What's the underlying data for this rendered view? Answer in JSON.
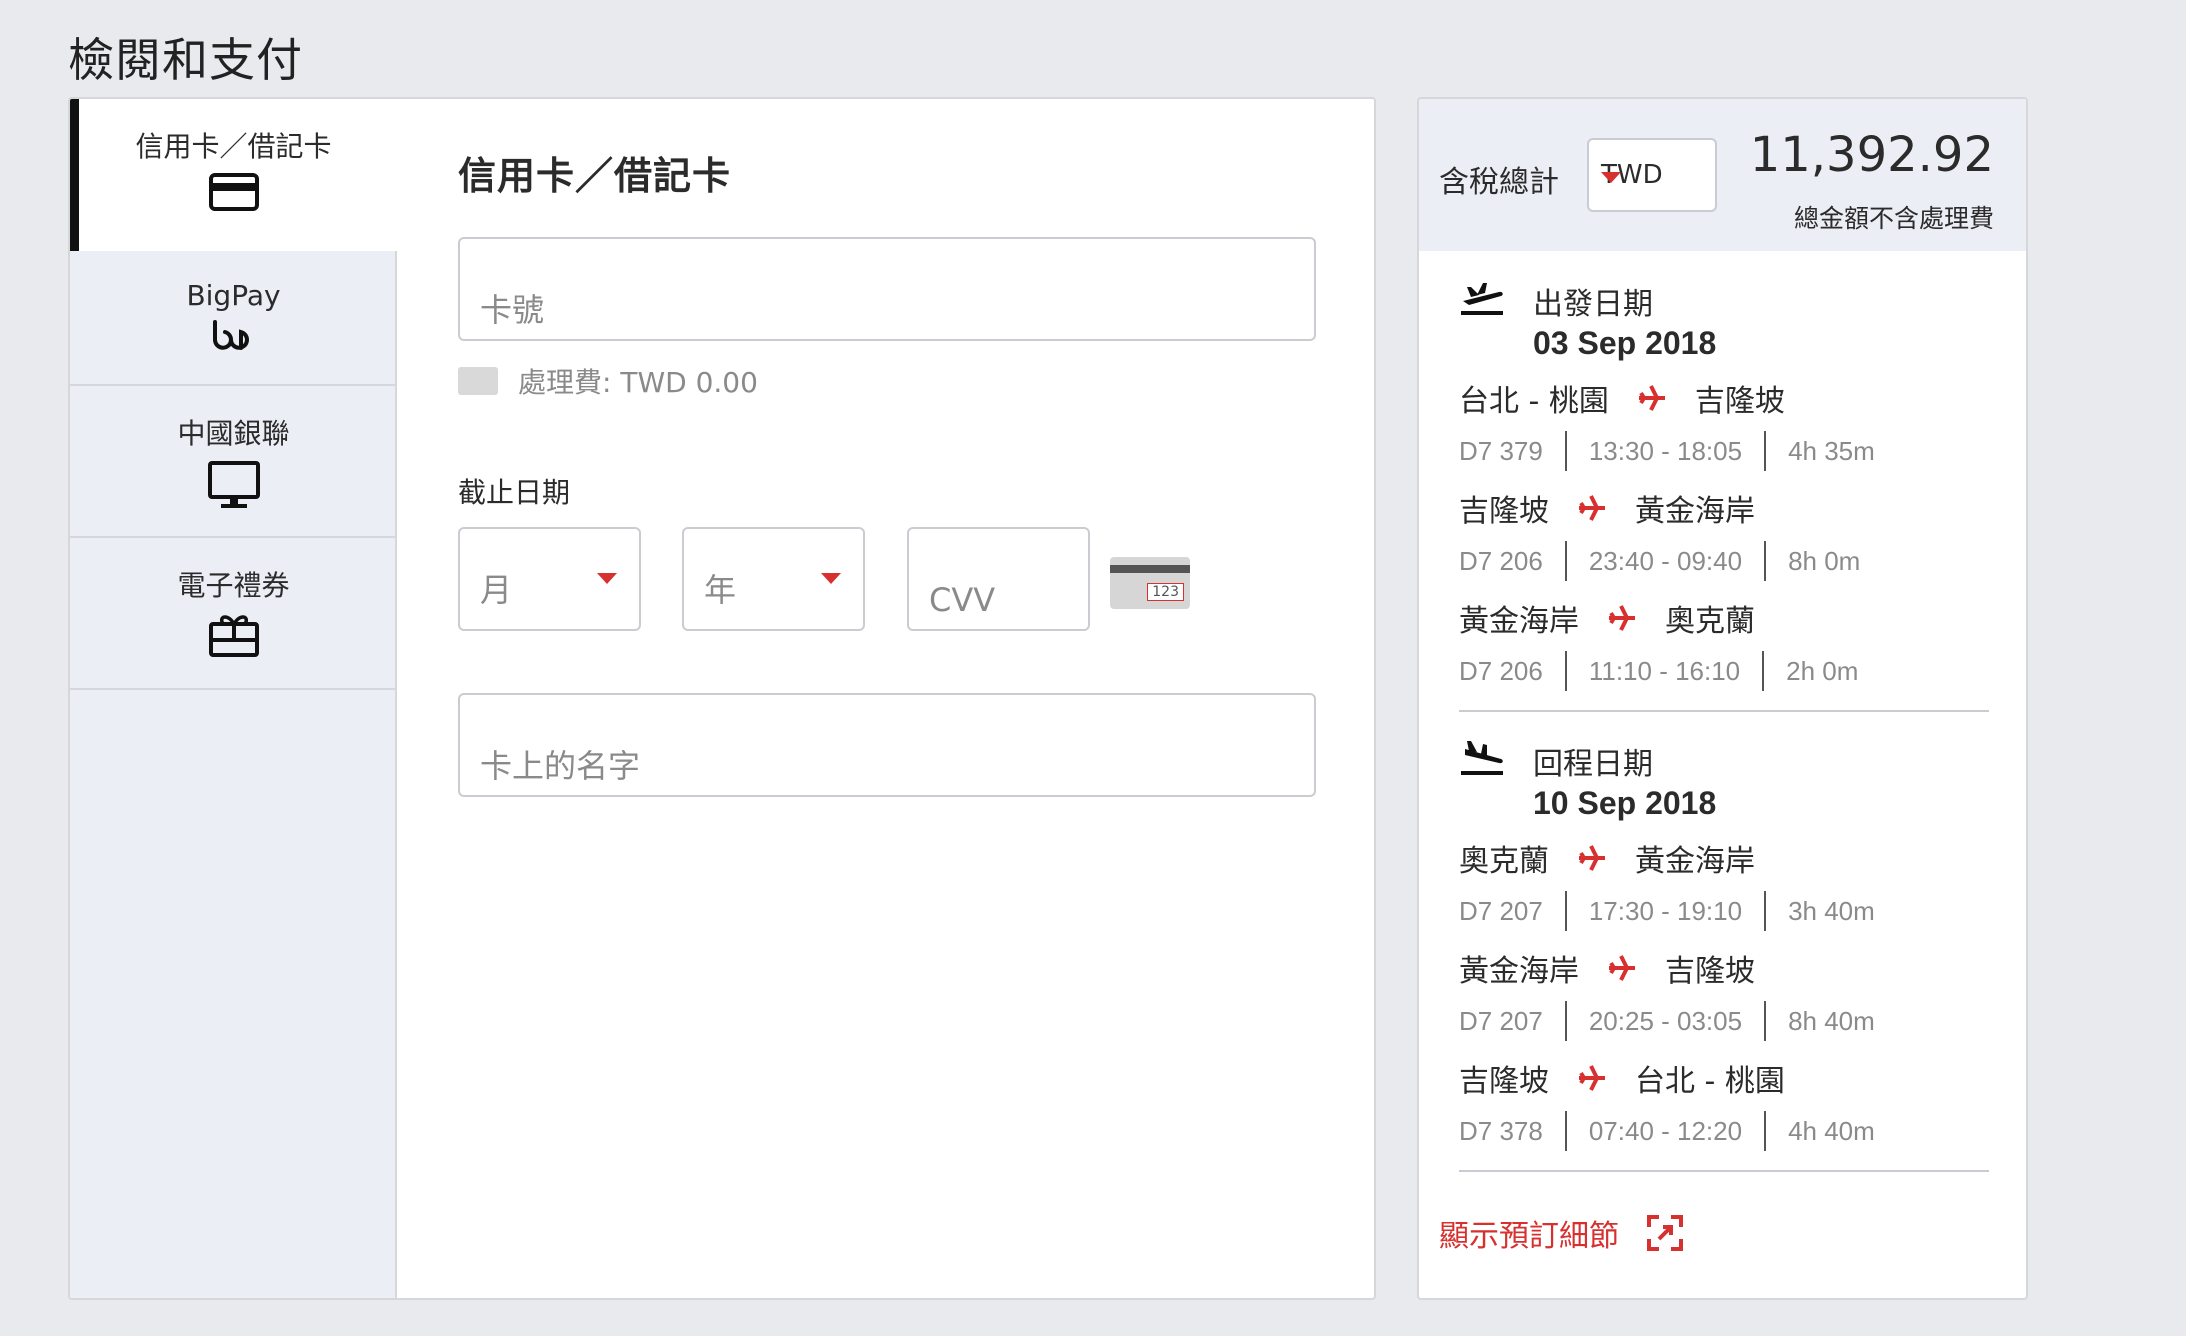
{
  "page": {
    "title": "檢閱和支付"
  },
  "colors": {
    "accent": "#d6302f",
    "panel_bg": "#eceef5",
    "page_bg": "#e9eaee"
  },
  "payment_tabs": [
    {
      "label": "信用卡／借記卡",
      "icon": "credit-card-icon",
      "active": true
    },
    {
      "label": "BigPay",
      "icon": "bigpay-icon",
      "active": false
    },
    {
      "label": "中國銀聯",
      "icon": "monitor-icon",
      "active": false
    },
    {
      "label": "電子禮券",
      "icon": "gift-card-icon",
      "active": false
    }
  ],
  "card_form": {
    "heading": "信用卡／借記卡",
    "card_number_placeholder": "卡號",
    "fee_text": "處理費: TWD 0.00",
    "expiry_label": "截止日期",
    "month_placeholder": "月",
    "year_placeholder": "年",
    "cvv_placeholder": "CVV",
    "cvv_card_number": "123",
    "name_placeholder": "卡上的名字"
  },
  "summary": {
    "total_label": "含稅總計",
    "currency": "TWD",
    "total_amount": "11,392.92",
    "total_note": "總金額不含處理費",
    "details_link": "顯示預訂細節",
    "departure": {
      "title": "出發日期",
      "date": "03 Sep 2018",
      "segments": [
        {
          "from": "台北 - 桃園",
          "to": "吉隆坡",
          "flight": "D7 379",
          "time": "13:30 - 18:05",
          "duration": "4h 35m"
        },
        {
          "from": "吉隆坡",
          "to": "黃金海岸",
          "flight": "D7 206",
          "time": "23:40 - 09:40",
          "duration": "8h 0m"
        },
        {
          "from": "黃金海岸",
          "to": "奧克蘭",
          "flight": "D7 206",
          "time": "11:10 - 16:10",
          "duration": "2h 0m"
        }
      ]
    },
    "return": {
      "title": "回程日期",
      "date": "10 Sep 2018",
      "segments": [
        {
          "from": "奧克蘭",
          "to": "黃金海岸",
          "flight": "D7 207",
          "time": "17:30 - 19:10",
          "duration": "3h 40m"
        },
        {
          "from": "黃金海岸",
          "to": "吉隆坡",
          "flight": "D7 207",
          "time": "20:25 - 03:05",
          "duration": "8h 40m"
        },
        {
          "from": "吉隆坡",
          "to": "台北 - 桃園",
          "flight": "D7 378",
          "time": "07:40 - 12:20",
          "duration": "4h 40m"
        }
      ]
    }
  }
}
